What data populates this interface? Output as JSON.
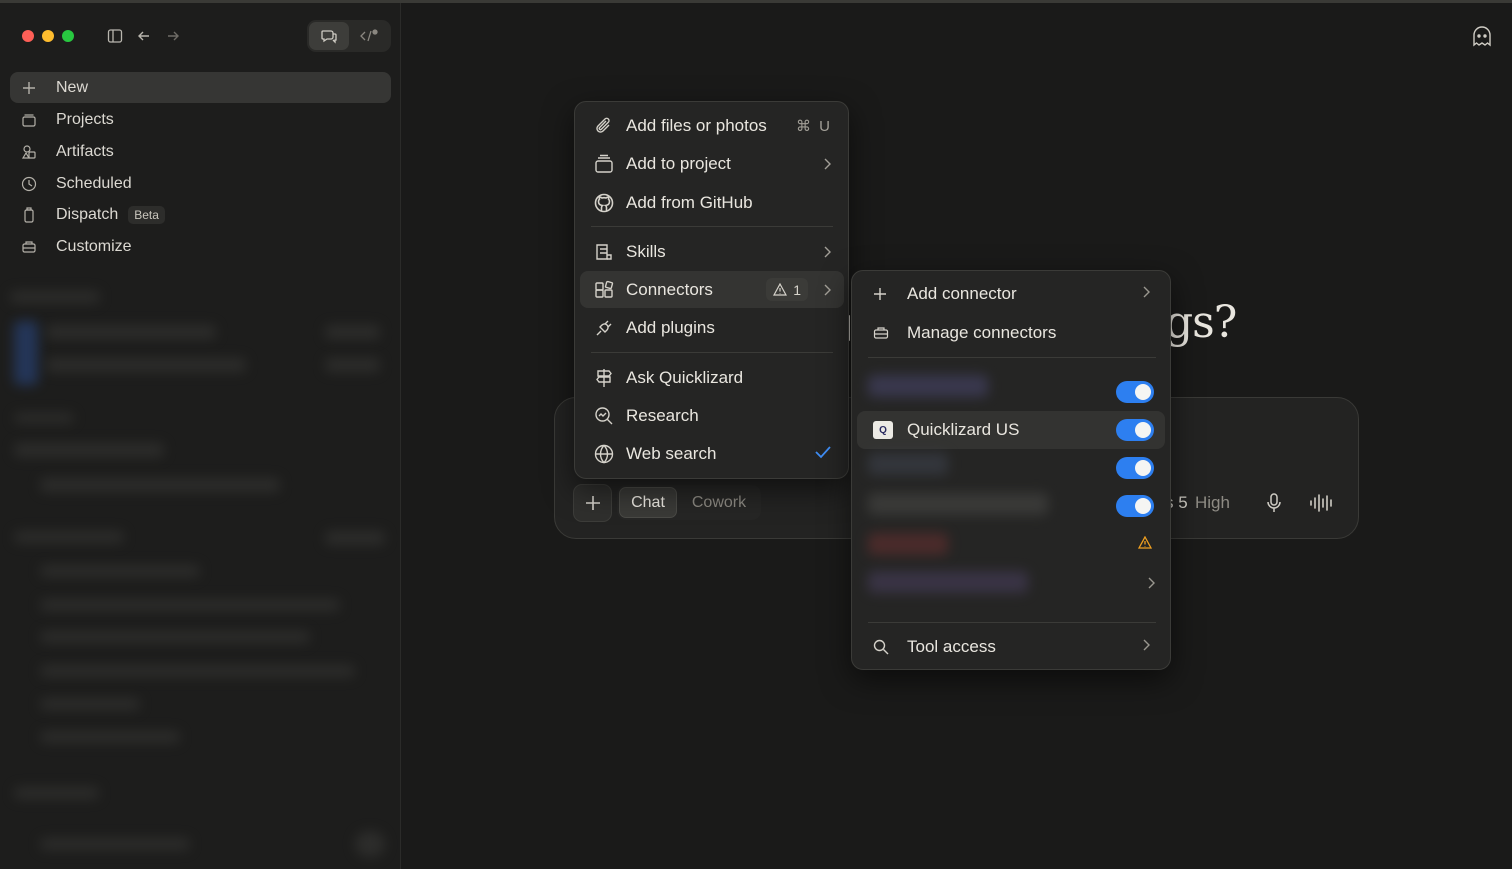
{
  "sidebar": {
    "items": [
      {
        "label": "New",
        "icon": "plus-icon"
      },
      {
        "label": "Projects",
        "icon": "projects-icon"
      },
      {
        "label": "Artifacts",
        "icon": "artifacts-icon"
      },
      {
        "label": "Scheduled",
        "icon": "clock-icon"
      },
      {
        "label": "Dispatch",
        "icon": "dispatch-icon",
        "badge": "Beta"
      },
      {
        "label": "Customize",
        "icon": "customize-icon"
      }
    ]
  },
  "main": {
    "heading_fragment": "gs?",
    "composer": {
      "modes": {
        "chat": "Chat",
        "cowork": "Cowork"
      },
      "model_fragment": "s 5",
      "effort": "High"
    }
  },
  "attach_menu": {
    "items": {
      "add_files": {
        "label": "Add files or photos",
        "shortcut": "⌘ U"
      },
      "add_project": {
        "label": "Add to project"
      },
      "add_github": {
        "label": "Add from GitHub"
      },
      "skills": {
        "label": "Skills"
      },
      "connectors": {
        "label": "Connectors",
        "warning_count": "1"
      },
      "plugins": {
        "label": "Add plugins"
      },
      "ask": {
        "label": "Ask Quicklizard"
      },
      "research": {
        "label": "Research"
      },
      "web_search": {
        "label": "Web search",
        "checked": true
      }
    }
  },
  "connectors_menu": {
    "add_connector": "Add connector",
    "manage_connectors": "Manage connectors",
    "quicklizard": {
      "label": "Quicklizard US",
      "logo": "Q",
      "enabled": true
    },
    "tool_access": "Tool access"
  },
  "colors": {
    "accent": "#2d7ff0",
    "warning": "#f0a020",
    "background": "#1a1a19",
    "menu": "#252524"
  }
}
